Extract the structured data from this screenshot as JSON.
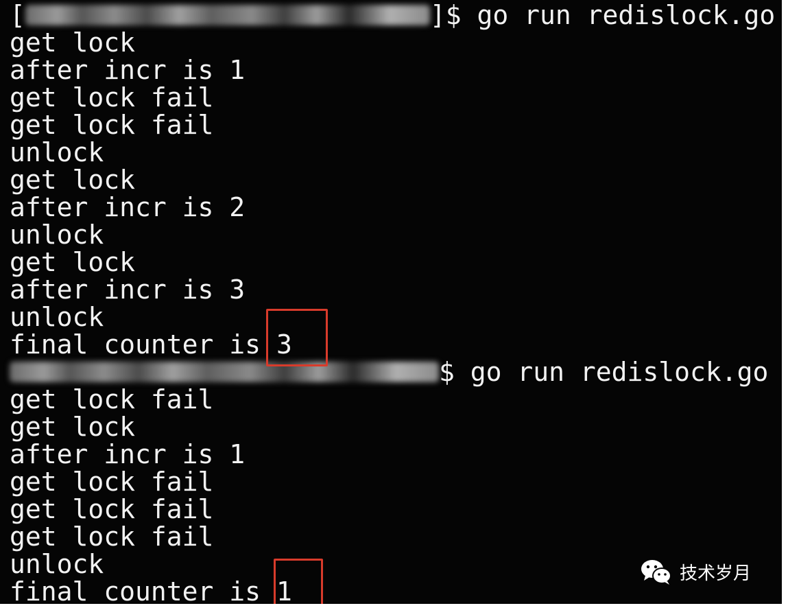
{
  "terminal": {
    "session1": {
      "prompt_suffix": "]$ go run redislock.go",
      "lines": [
        "get lock",
        "after incr is 1",
        "get lock fail",
        "get lock fail",
        "unlock",
        "get lock",
        "after incr is 2",
        "unlock",
        "get lock",
        "after incr is 3",
        "unlock"
      ],
      "final_prefix": "final counter is ",
      "final_value": "3"
    },
    "session2": {
      "prompt_suffix": "$ go run redislock.go",
      "lines": [
        "get lock fail",
        "get lock",
        "after incr is 1",
        "get lock fail",
        "get lock fail",
        "get lock fail",
        "unlock"
      ],
      "final_prefix": "final counter is ",
      "final_value": "1"
    }
  },
  "watermark": {
    "icon": "wechat-icon",
    "text": "技术岁月"
  },
  "colors": {
    "background": "#050505",
    "text": "#f2f2f2",
    "highlight": "#d83b2b"
  }
}
